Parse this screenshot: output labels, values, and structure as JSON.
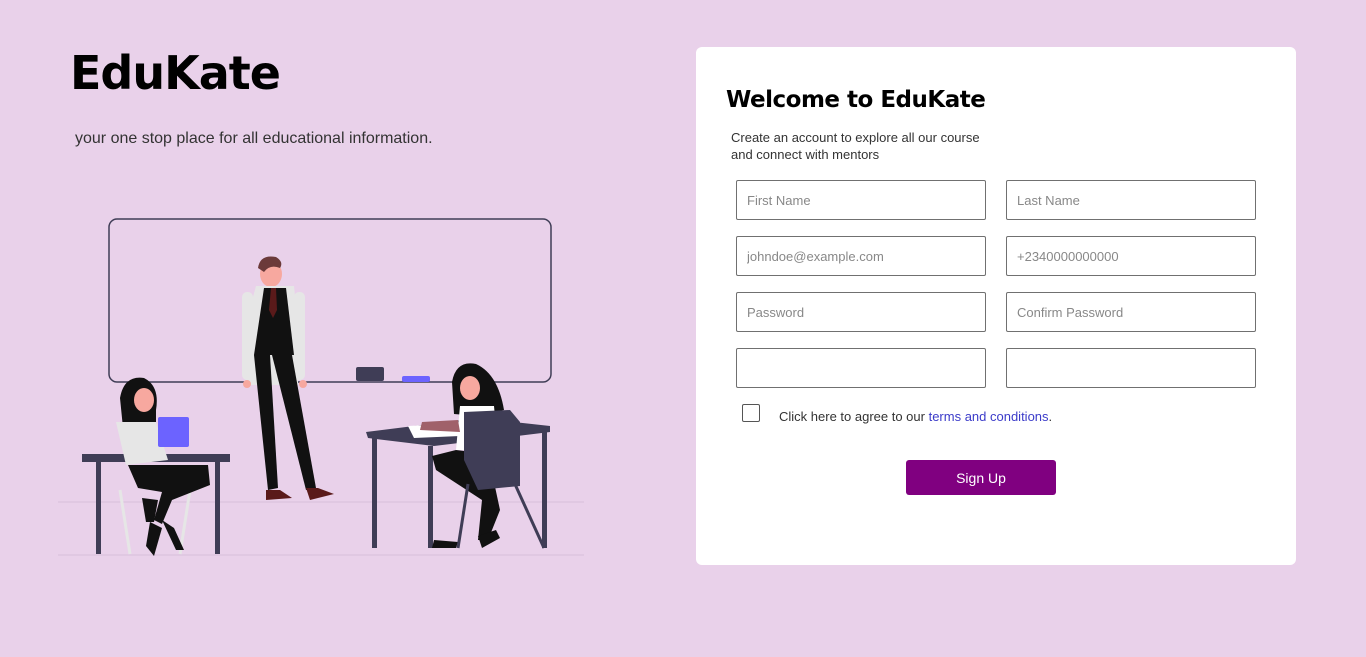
{
  "brand": {
    "name": "EduKate",
    "tagline": "your one stop place for all educational information."
  },
  "form": {
    "title": "Welcome to EduKate",
    "subtitle": "Create an account to explore all our course and connect with mentors",
    "fields": {
      "first_name_placeholder": "First Name",
      "last_name_placeholder": "Last Name",
      "email_placeholder": "johndoe@example.com",
      "phone_placeholder": "+2340000000000",
      "password_placeholder": "Password",
      "confirm_password_placeholder": "Confirm Password",
      "extra_left_placeholder": "",
      "extra_right_placeholder": ""
    },
    "agree_text": "Click here to agree to our ",
    "terms_link": "terms and conditions",
    "agree_suffix": ".",
    "submit_label": "Sign Up"
  },
  "colors": {
    "page_background": "#e9d1ea",
    "primary_button": "#800080",
    "link": "#3b3bc9",
    "illustration_accent": "#6c63ff",
    "illustration_dark": "#3f3d56"
  },
  "illustration": {
    "icon": "classroom-illustration"
  }
}
